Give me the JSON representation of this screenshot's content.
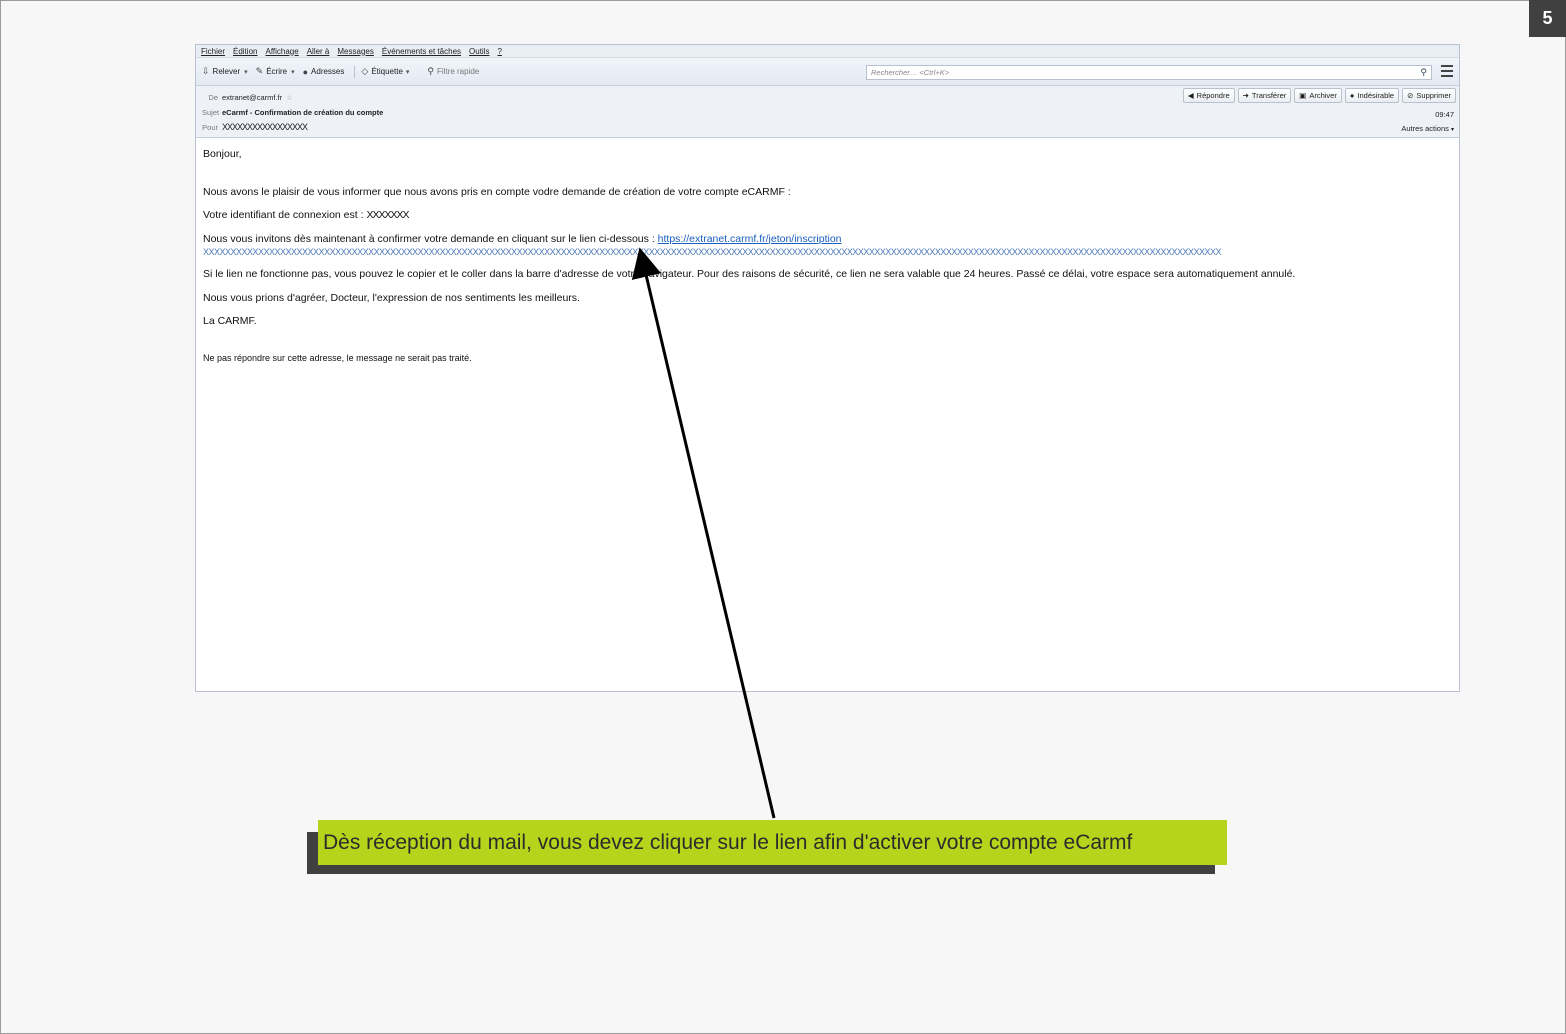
{
  "page_number": "5",
  "menubar": {
    "items": [
      "Fichier",
      "Édition",
      "Affichage",
      "Aller à",
      "Messages",
      "Événements et tâches",
      "Outils",
      "?"
    ]
  },
  "toolbar": {
    "relever": "Relever",
    "ecrire": "Écrire",
    "adresses": "Adresses",
    "etiquette": "Étiquette",
    "filtre": "Filtre rapide",
    "search_placeholder": "Rechercher… <Ctrl+K>"
  },
  "header": {
    "from_label": "De",
    "from_value": "extranet@carmf.fr",
    "subject_label": "Sujet",
    "subject_value": "eCarmf - Confirmation de création du compte",
    "to_label": "Pour",
    "to_value": "XXXXXXXXXXXXXXXXX",
    "time": "09:47",
    "more_actions": "Autres actions",
    "buttons": [
      "Répondre",
      "Transférer",
      "Archiver",
      "Indésirable",
      "Supprimer"
    ]
  },
  "body": {
    "greeting": "Bonjour,",
    "line1": "Nous avons le plaisir de vous informer que nous avons pris en compte vodre demande de création de votre compte eCARMF :",
    "line2_prefix": "Votre identifiant de connexion est :",
    "line2_value": "XXXXXXX",
    "line3_prefix": "Nous vous invitons dès maintenant à confirmer votre demande en cliquant sur le lien ci-dessous :",
    "link": "https://extranet.carmf.fr/jeton/inscription",
    "token": "XXXXXXXXXXXXXXXXXXXXXXXXXXXXXXXXXXXXXXXXXXXXXXXXXXXXXXXXXXXXXXXXXXXXXXXXXXXXXXXXXXXXXXXXXXXXXXXXXXXXXXXXXXXXXXXXXXXXXXXXXXXXXXXXXXXXXXXXXXXXXXXXXXXXXXXXXXXXXXXXXXXXXXXXXXXXXXXXXXXXXXXXX",
    "line4": "Si le lien ne fonctionne pas, vous pouvez le copier et le coller dans la barre d'adresse de votre navigateur. Pour des raisons de sécurité, ce lien ne sera valable que 24 heures. Passé ce délai, votre espace sera automatiquement annulé.",
    "line5": "Nous vous prions d'agréer, Docteur, l'expression de nos sentiments les meilleurs.",
    "signature": "La CARMF.",
    "footer": "Ne pas répondre sur cette adresse, le message ne serait pas traité."
  },
  "callout": {
    "text": "Dès réception du mail, vous devez cliquer sur le lien afin d'activer votre compte eCarmf"
  },
  "colors": {
    "callout_bg": "#b5d41b",
    "link": "#1a5fbf",
    "badge_bg": "#404040"
  }
}
